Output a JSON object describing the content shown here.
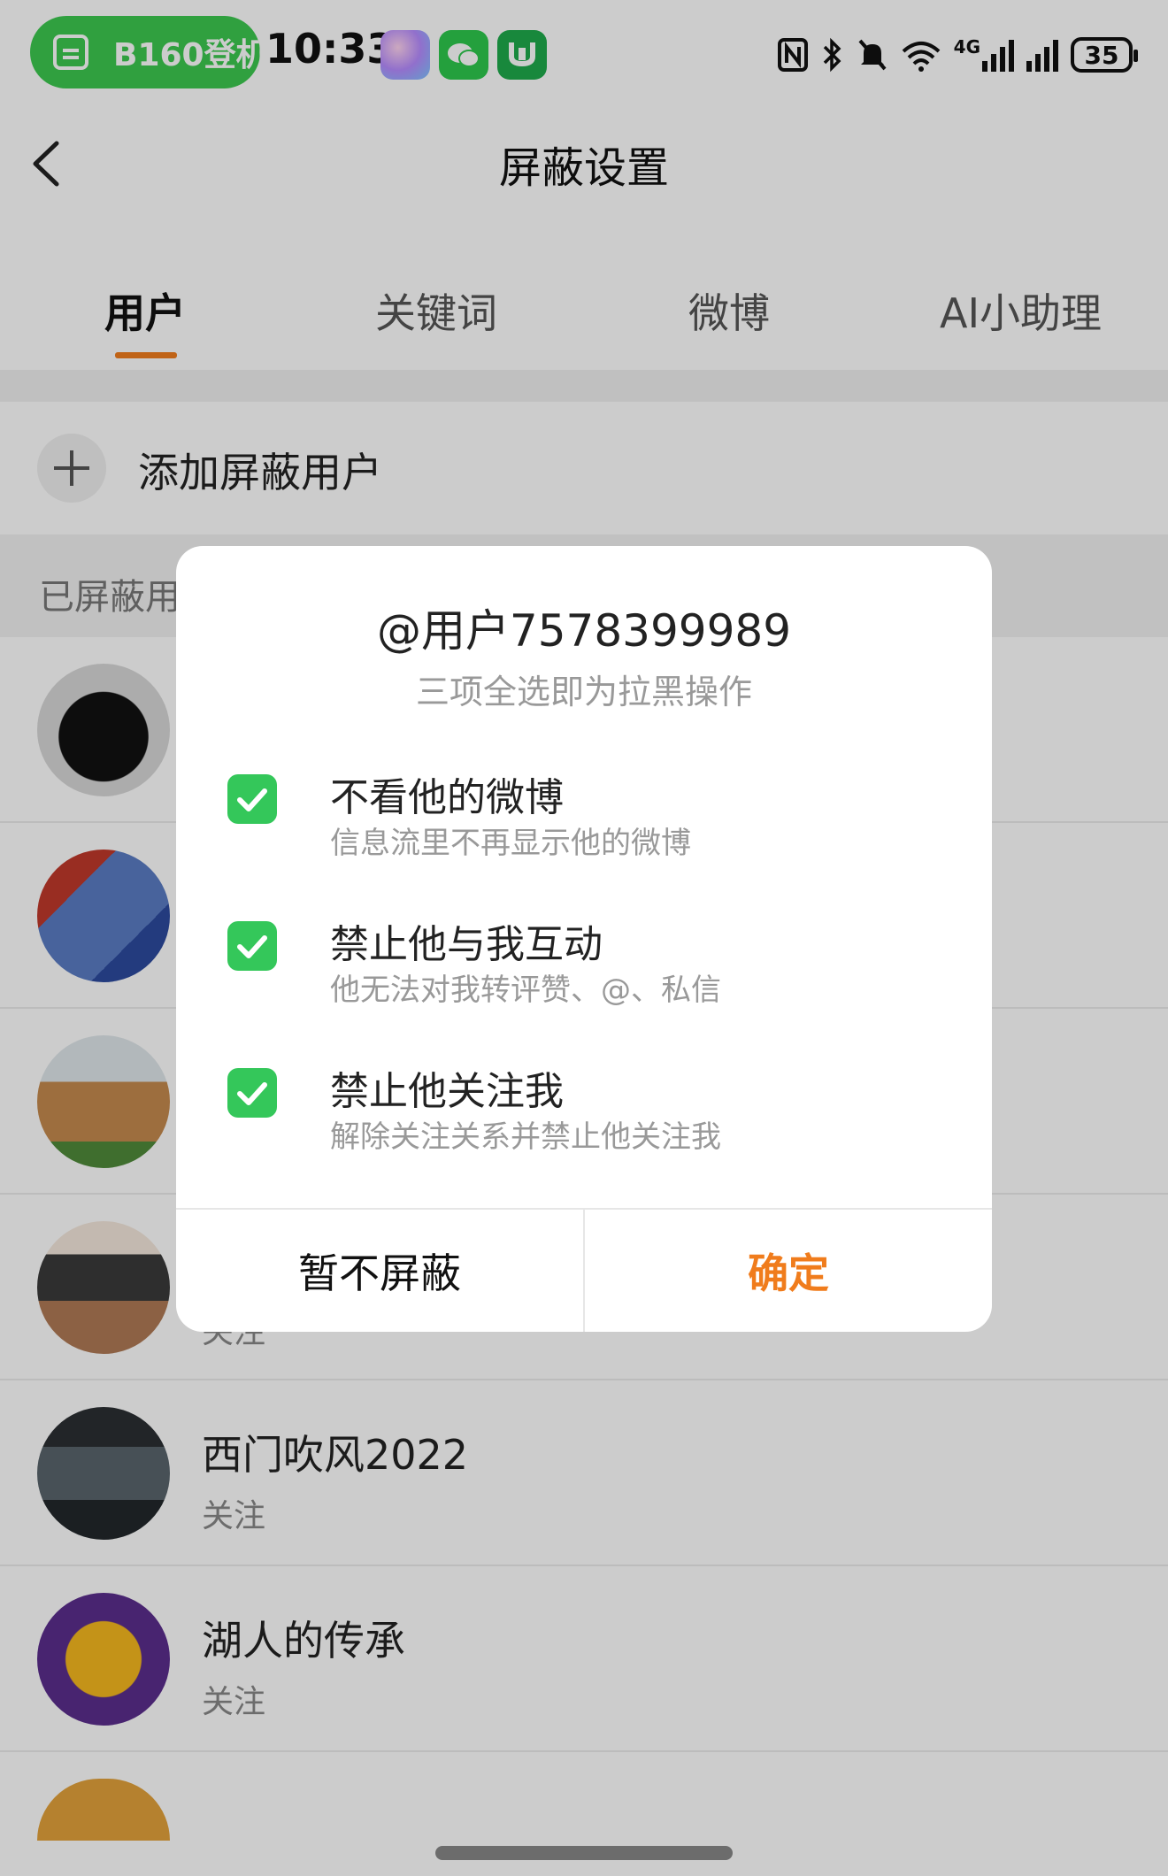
{
  "status_bar": {
    "pill_text": "B160登机",
    "time": "10:33",
    "network": "4G",
    "battery": "35",
    "icons": [
      "boarding-pass-icon",
      "assistant-app-icon",
      "wechat-icon",
      "green-app-icon",
      "nfc-icon",
      "bluetooth-icon",
      "mute-icon",
      "wifi-icon",
      "signal-icon",
      "battery-icon"
    ]
  },
  "header": {
    "title": "屏蔽设置"
  },
  "tabs": [
    {
      "label": "用户",
      "active": true
    },
    {
      "label": "关键词",
      "active": false
    },
    {
      "label": "微博",
      "active": false
    },
    {
      "label": "AI小助理",
      "active": false
    }
  ],
  "add_user": {
    "label": "添加屏蔽用户"
  },
  "section": {
    "label": "已屏蔽用户"
  },
  "users": [
    {
      "name": "",
      "status": ""
    },
    {
      "name": "",
      "status": ""
    },
    {
      "name": "",
      "status": ""
    },
    {
      "name": "",
      "status": "关注"
    },
    {
      "name": "西门吹风2022",
      "status": "关注"
    },
    {
      "name": "湖人的传承",
      "status": "关注"
    }
  ],
  "dialog": {
    "title": "@用户7578399989",
    "subtitle": "三项全选即为拉黑操作",
    "options": [
      {
        "title": "不看他的微博",
        "desc": "信息流里不再显示他的微博",
        "checked": true
      },
      {
        "title": "禁止他与我互动",
        "desc": "他无法对我转评赞、@、私信",
        "checked": true
      },
      {
        "title": "禁止他关注我",
        "desc": "解除关注关系并禁止他关注我",
        "checked": true
      }
    ],
    "cancel_label": "暂不屏蔽",
    "confirm_label": "确定"
  },
  "colors": {
    "accent": "#f07c1c",
    "check": "#34c75a",
    "pill": "#3cc94f"
  }
}
